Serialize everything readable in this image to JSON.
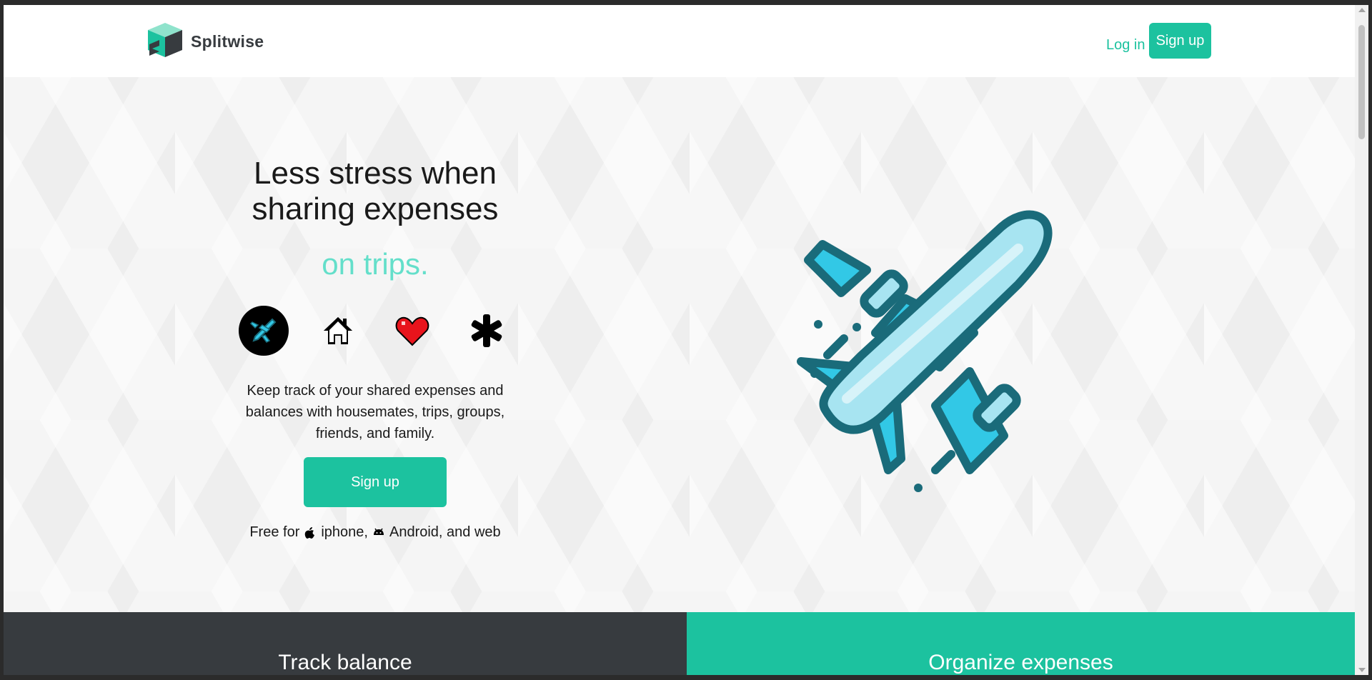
{
  "header": {
    "brand": "Splitwise",
    "login_label": "Log in",
    "signup_label": "Sign up"
  },
  "hero": {
    "headline_line1": "Less stress when",
    "headline_line2": "sharing expenses",
    "tagline": "on trips.",
    "categories": [
      {
        "name": "trips",
        "icon": "airplane-icon",
        "active": true
      },
      {
        "name": "housemates",
        "icon": "house-icon",
        "active": false
      },
      {
        "name": "partner",
        "icon": "heart-icon",
        "active": false
      },
      {
        "name": "anyone",
        "icon": "asterisk-icon",
        "active": false
      }
    ],
    "description": "Keep track of your shared expenses and balances with housemates, trips, groups, friends, and family.",
    "signup_label": "Sign up",
    "platforms_prefix": "Free for",
    "platform_iphone": "iphone,",
    "platform_android": "Android, and web"
  },
  "panels": {
    "left_title": "Track balance",
    "right_title": "Organize expenses"
  },
  "colors": {
    "brand_green": "#1cc29f",
    "tagline_teal": "#64dfca",
    "dark_panel": "#373b3f",
    "plane_blue": "#32c8e6",
    "plane_outline": "#1a6b7a"
  }
}
